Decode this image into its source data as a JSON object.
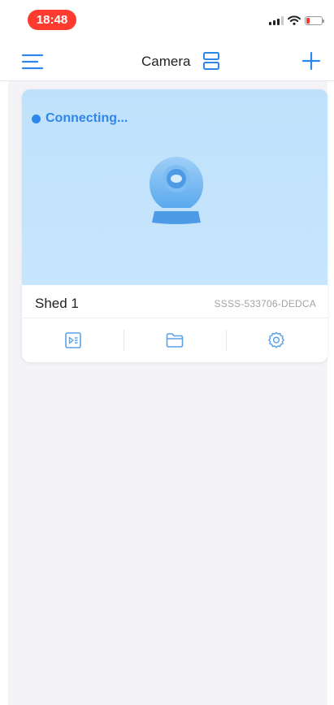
{
  "status_bar": {
    "time": "18:48",
    "icons": [
      "signal-icon",
      "wifi-icon",
      "battery-icon"
    ],
    "time_pill_color": "#ff3b30"
  },
  "nav": {
    "title": "Camera",
    "icons": [
      "menu-icon",
      "layout-icon",
      "add-icon"
    ],
    "accent_color": "#2f86ec"
  },
  "camera_card": {
    "status": "Connecting...",
    "name": "Shed 1",
    "device_id": "SSSS-533706-DEDCA",
    "preview_color": "#c5e4fc",
    "actions": [
      {
        "name": "playback",
        "icon": "playback-icon"
      },
      {
        "name": "files",
        "icon": "folder-icon"
      },
      {
        "name": "settings",
        "icon": "gear-icon"
      }
    ]
  }
}
